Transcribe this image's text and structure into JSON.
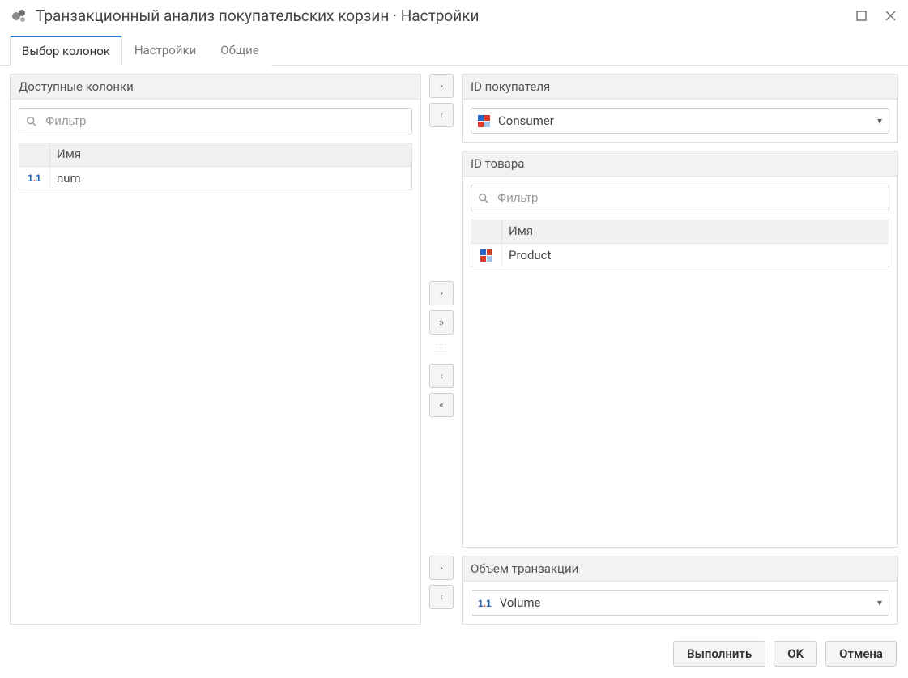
{
  "window": {
    "title": "Транзакционный анализ покупательских корзин · Настройки"
  },
  "tabs": {
    "columns": "Выбор колонок",
    "settings": "Настройки",
    "general": "Общие"
  },
  "left": {
    "header": "Доступные колонки",
    "filter_placeholder": "Фильтр",
    "col_name_header": "Имя",
    "rows": [
      {
        "name": "num",
        "icon": "num"
      }
    ]
  },
  "consumer": {
    "header": "ID покупателя",
    "selected": "Consumer"
  },
  "product": {
    "header": "ID товара",
    "filter_placeholder": "Фильтр",
    "col_name_header": "Имя",
    "rows": [
      {
        "name": "Product",
        "icon": "cat"
      }
    ]
  },
  "volume": {
    "header": "Объем транзакции",
    "selected": "Volume"
  },
  "footer": {
    "run": "Выполнить",
    "ok": "OK",
    "cancel": "Отмена"
  }
}
